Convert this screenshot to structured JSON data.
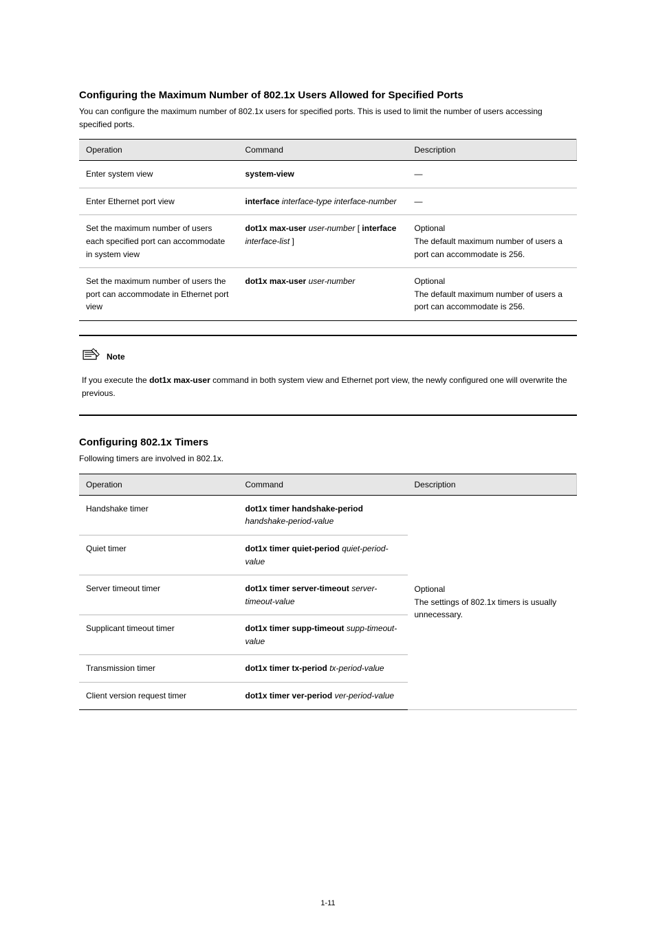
{
  "section_heading": "Configuring the Maximum Number of 802.1x Users Allowed for Specified Ports",
  "intro_para": "You can configure the maximum number of 802.1x users for specified ports. This is used to limit the number of users accessing specified ports.",
  "table1": {
    "headers": [
      "Operation",
      "Command",
      "Description"
    ],
    "rows": [
      {
        "op": "Enter system view",
        "cmd": "system-view",
        "desc": "—"
      },
      {
        "op": "Enter Ethernet port view",
        "cmd_parts": [
          "interface",
          "interface-type interface-number"
        ],
        "desc": "—"
      },
      {
        "op": "Set the maximum number of users each specified port can accommodate in system view",
        "cmd_parts": [
          "dot1x max-user",
          "user-number",
          "[",
          "interface",
          "interface-list",
          "]"
        ],
        "desc": "Optional\nThe default maximum number of users a port can accommodate is 256."
      },
      {
        "op": "Set the maximum number of users the port can accommodate in Ethernet port view",
        "cmd_parts": [
          "dot1x max-user",
          "user-number"
        ],
        "desc": "Optional\nThe default maximum number of users a port can accommodate is 256."
      }
    ]
  },
  "note_label": "Note",
  "note_text_parts": [
    "If you execute the ",
    "dot1x max-user",
    " command in both system view and Ethernet port view, the newly configured one will overwrite the previous."
  ],
  "section2_heading": "Configuring 802.1x Timers",
  "section2_para": "Following timers are involved in 802.1x.",
  "table2": {
    "headers": [
      "Operation",
      "Command",
      "Description"
    ],
    "rows": [
      {
        "op": "Handshake timer",
        "cmd_parts": [
          "dot1x timer",
          "handshake-period",
          "handshake-period-value"
        ],
        "desc": ""
      },
      {
        "op": "Quiet timer",
        "cmd_parts": [
          "dot1x timer quiet-period",
          "quiet-period-value"
        ],
        "desc": ""
      },
      {
        "op": "Server timeout timer",
        "cmd_parts": [
          "dot1x timer server-timeout",
          "server-timeout-value"
        ],
        "desc": ""
      },
      {
        "op": "Supplicant timeout timer",
        "cmd_parts": [
          "dot1x timer supp-timeout",
          "supp-timeout-value"
        ],
        "desc": ""
      },
      {
        "op": "Transmission timer",
        "cmd_parts": [
          "dot1x timer tx-period",
          "tx-period-value"
        ],
        "desc": ""
      },
      {
        "op": "Client version request timer",
        "cmd_parts": [
          "dot1x timer ver-period",
          "ver-period-value"
        ],
        "desc": ""
      }
    ],
    "merged_desc": "Optional\nThe settings of 802.1x timers is usually unnecessary."
  },
  "page_number": "1-11"
}
